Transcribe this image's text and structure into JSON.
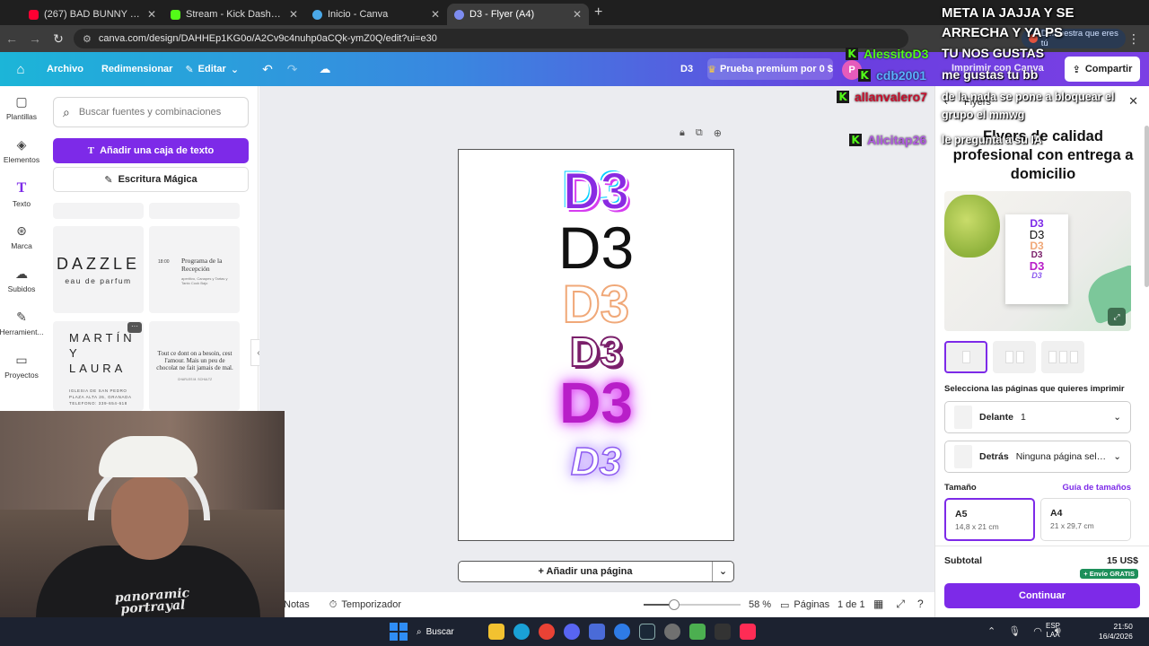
{
  "browser": {
    "tabs": [
      {
        "title": "(267) BAD BUNNY x DADDY YA",
        "icon_color": "#ff0033",
        "active": false
      },
      {
        "title": "Stream - Kick Dashboard",
        "icon_color": "#53fc18",
        "active": false
      },
      {
        "title": "Inicio - Canva",
        "icon_color": "#4aa8e8",
        "active": false
      },
      {
        "title": "D3 - Flyer (A4)",
        "icon_color": "#7d8cf0",
        "active": true
      }
    ],
    "url": "canva.com/design/DAHHEp1KG0o/A2Cv9c4nuhp0aCQk-ymZ0Q/edit?ui=e30",
    "profile_badge": "Demuestra que eres tú"
  },
  "header": {
    "archivo": "Archivo",
    "redimensionar": "Redimensionar",
    "editar": "Editar",
    "doc_name": "D3",
    "premium": "Prueba premium por 0 $",
    "avatar_letter": "P",
    "print": "Imprimir con Canva",
    "share": "Compartir"
  },
  "rail": [
    {
      "label": "Plantillas",
      "icon": "template-icon"
    },
    {
      "label": "Elementos",
      "icon": "elements-icon"
    },
    {
      "label": "Texto",
      "icon": "text-icon",
      "active": true
    },
    {
      "label": "Marca",
      "icon": "brand-icon"
    },
    {
      "label": "Subidos",
      "icon": "upload-icon"
    },
    {
      "label": "Herramient...",
      "icon": "tools-icon"
    },
    {
      "label": "Proyectos",
      "icon": "folder-icon"
    }
  ],
  "panel": {
    "search_placeholder": "Buscar fuentes y combinaciones",
    "add_text": "Añadir una caja de texto",
    "magic": "Escritura Mágica",
    "tiles": {
      "dazzle": "DAZZLE",
      "dazzle_sub": "eau de parfum",
      "prog_time": "18:00",
      "prog_title": "Programa de la Recepción",
      "prog_sub": "aperitivo, Canapes y Tartas y Tanto Cook Bajo",
      "martin": "MARTÍN\nY\nLAURA",
      "martin_sub": "IGLESIA DE SAN PEDRO\nPLAZA ALTA 26, GRANADA\nTELEFONO: 339-654-618",
      "tout": "Tout ce dont on a besoin, cest l'amour. Mais un peu de chocolat ne fait jamais de mal.",
      "tout_sig": "CHARLES M. SCHULTZ"
    }
  },
  "canvas": {
    "d3_variants": [
      "D3",
      "D3",
      "D3",
      "D3",
      "D3",
      "D3"
    ],
    "add_page": "Añadir una página"
  },
  "bottom_bar": {
    "notas": "Notas",
    "timer": "Temporizador",
    "zoom": "58 %",
    "zoom_level": 0.58,
    "pages": "Páginas",
    "page_count": "1 de 1"
  },
  "print_panel": {
    "crumb": "Flyers",
    "title": "Flyers de calidad profesional con entrega a domicilio",
    "mini_d3": [
      "D3",
      "D3",
      "D3",
      "D3",
      "D3",
      "D3"
    ],
    "select_label": "Selecciona las páginas que quieres imprimir",
    "front_label": "Delante",
    "front_value": "1",
    "back_label": "Detrás",
    "back_value": "Ninguna página seleccionada",
    "size_label": "Tamaño",
    "size_guide": "Guía de tamaños",
    "sizes": [
      {
        "name": "A5",
        "dims": "14,8 x 21 cm",
        "active": true
      },
      {
        "name": "A4",
        "dims": "21 x 29,7 cm",
        "active": false
      }
    ],
    "subtotal_label": "Subtotal",
    "subtotal_value": "15 US$",
    "shipping": "+ Envío GRATIS",
    "continue": "Continuar"
  },
  "stream_overlay": {
    "message": "META IA JAJJA Y SE ARRECHA Y YA PS",
    "chat": [
      {
        "user": "AlessitoD3",
        "color": "#53fc18",
        "text": "TU NOS GUSTAS"
      },
      {
        "user": "cdb2001",
        "color": "#5ab0ff",
        "text": "me gustas tu bb"
      },
      {
        "user": "allanvalero7",
        "color": "#c8102e",
        "text": "de la nada se pone a bloquear el grupo el mmwg"
      },
      {
        "user": "Alicitap26",
        "color": "#b05be0",
        "text": "le pregunta a su IA"
      }
    ],
    "shirt_text": "panoramic\nportrayal"
  },
  "taskbar": {
    "search": "Buscar",
    "lang_top": "ESP",
    "lang_bottom": "LAA",
    "time": "21:50",
    "date": "16/4/2026"
  }
}
